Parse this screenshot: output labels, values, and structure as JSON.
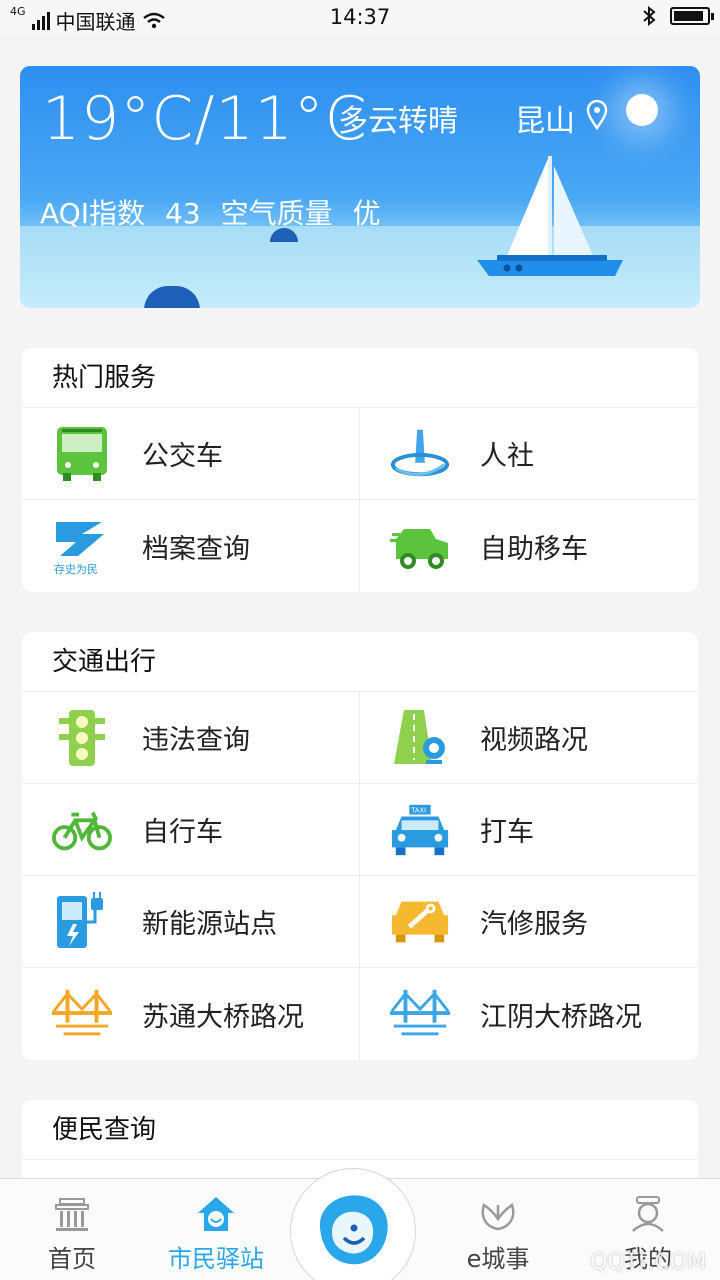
{
  "status_bar": {
    "carrier": "中国联通",
    "net": "4G",
    "time": "14:37"
  },
  "weather": {
    "temperature": "19°C/11°C",
    "condition": "多云转晴",
    "city": "昆山",
    "aqi_label": "AQI指数",
    "aqi_value": "43",
    "quality_label": "空气质量",
    "quality_value": "优"
  },
  "sections": [
    {
      "title": "热门服务",
      "items": [
        {
          "label": "公交车",
          "icon": "bus-icon"
        },
        {
          "label": "人社",
          "icon": "social-security-icon"
        },
        {
          "label": "档案查询",
          "icon": "archive-icon"
        },
        {
          "label": "自助移车",
          "icon": "move-car-icon"
        }
      ]
    },
    {
      "title": "交通出行",
      "items": [
        {
          "label": "违法查询",
          "icon": "traffic-light-icon"
        },
        {
          "label": "视频路况",
          "icon": "road-camera-icon"
        },
        {
          "label": "自行车",
          "icon": "bicycle-icon"
        },
        {
          "label": "打车",
          "icon": "taxi-icon"
        },
        {
          "label": "新能源站点",
          "icon": "charging-station-icon"
        },
        {
          "label": "汽修服务",
          "icon": "car-repair-icon"
        },
        {
          "label": "苏通大桥路况",
          "icon": "bridge-orange-icon"
        },
        {
          "label": "江阴大桥路况",
          "icon": "bridge-blue-icon"
        }
      ]
    },
    {
      "title": "便民查询",
      "items": []
    }
  ],
  "archive_icon_caption": "存史为民",
  "taxi_sign": "TAXI",
  "tabs": [
    {
      "label": "首页",
      "icon": "home-building-icon"
    },
    {
      "label": "市民驿站",
      "icon": "citizen-station-icon",
      "active": true
    },
    {
      "label": "e城事",
      "icon": "city-affairs-icon"
    },
    {
      "label": "我的",
      "icon": "profile-icon"
    }
  ],
  "watermark": "QQTF.COM",
  "colors": {
    "accent": "#2aa7ea",
    "weather_top": "#2d8ff0",
    "green": "#5cc43c",
    "orange": "#f5a623"
  }
}
